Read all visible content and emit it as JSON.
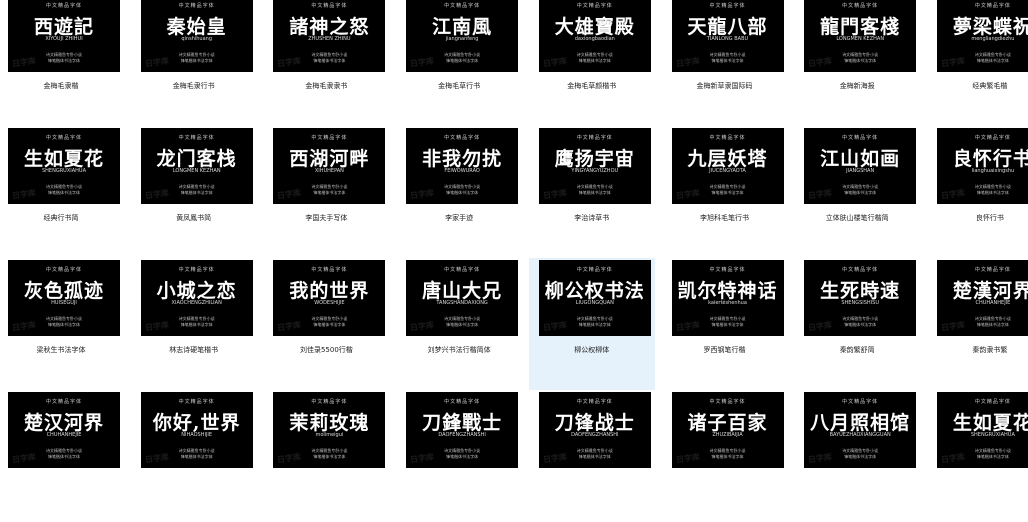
{
  "thumb_header": "中文精品字体",
  "thumb_footer_1": "诗文精雅鱼专卧小谈",
  "thumb_footer_2": "锋笔楷体书法字体",
  "watermark": "日字库",
  "items": [
    {
      "name": "sample-xiyouji",
      "sample": "西遊記",
      "sub": "XIYOUJI ZHIHUI",
      "label": "金梅毛隶楷",
      "selected": false
    },
    {
      "name": "sample-qinshihuang",
      "sample": "秦始皇",
      "sub": "qinshihuang",
      "label": "金梅毛隶行书",
      "selected": false
    },
    {
      "name": "sample-zhushen",
      "sample": "諸神之怒",
      "sub": "ZHUSHEN ZHINU",
      "label": "金梅毛隶隶书",
      "selected": false
    },
    {
      "name": "sample-jiangnanfeng",
      "sample": "江南風",
      "sub": "jiangnanfeng",
      "label": "金梅毛草行书",
      "selected": false
    },
    {
      "name": "sample-daxiong",
      "sample": "大雄寶殿",
      "sub": "daxiongbaodian",
      "label": "金梅毛草颜楷书",
      "selected": false
    },
    {
      "name": "sample-tianlong",
      "sample": "天龍八部",
      "sub": "TIANLONG BABU",
      "label": "金梅新草隶国际码",
      "selected": false
    },
    {
      "name": "sample-longmen",
      "sample": "龍門客棧",
      "sub": "LONGMEN KEZHAN",
      "label": "金梅新海报",
      "selected": false
    },
    {
      "name": "sample-mengliang",
      "sample": "夢梁蝶祝",
      "sub": "mengliangdiezhu",
      "label": "经典繁毛楷",
      "selected": false
    },
    {
      "name": "sample-shengru",
      "sample": "生如夏花",
      "sub": "SHENGRUXIAHUA",
      "label": "经典行书简",
      "selected": false
    },
    {
      "name": "sample-longmenkezhan",
      "sample": "龙门客栈",
      "sub": "LONGMEN KEZHAN",
      "label": "黄凤鳳书简",
      "selected": false
    },
    {
      "name": "sample-xihu",
      "sample": "西湖河畔",
      "sub": "XIHUHEPAN",
      "label": "李国夫手写体",
      "selected": false
    },
    {
      "name": "sample-feiwo",
      "sample": "非我勿扰",
      "sub": "FEIWOWURAO",
      "label": "李家手迹",
      "selected": false
    },
    {
      "name": "sample-yingyu",
      "sample": "鹰扬宇宙",
      "sub": "YINGYANGYUZHOU",
      "label": "李治诗草书",
      "selected": false
    },
    {
      "name": "sample-jiuceng",
      "sample": "九层妖塔",
      "sub": "JIUCENGYAOTA",
      "label": "李旭科毛笔行书",
      "selected": false
    },
    {
      "name": "sample-jiangshan",
      "sample": "江山如画",
      "sub": "JIANGSHAN",
      "label": "立体肤山楼笔行楷简",
      "selected": false
    },
    {
      "name": "sample-lianghuai",
      "sample": "良怀行书",
      "sub": "lianghuaixingshu",
      "label": "良怀行书",
      "selected": false
    },
    {
      "name": "sample-huiselinian",
      "sample": "灰色孤迹",
      "sub": "HUISEGUJI",
      "label": "梁秋生书法字体",
      "selected": false
    },
    {
      "name": "sample-xiaocheng",
      "sample": "小城之恋",
      "sub": "XIAOCHENGZHILIAN",
      "label": "林志诗硬笔楷书",
      "selected": false
    },
    {
      "name": "sample-wode",
      "sample": "我的世界",
      "sub": "WODESHIJIE",
      "label": "刘佳录5500行楷",
      "selected": false
    },
    {
      "name": "sample-tangshan",
      "sample": "唐山大兄",
      "sub": "TANGSHANDAXIONG",
      "label": "刘梦兴书法行楷简体",
      "selected": false
    },
    {
      "name": "sample-liugongquan",
      "sample": "柳公权书法",
      "sub": "LIUGONGQUAN",
      "label": "柳公权柳体",
      "selected": true
    },
    {
      "name": "sample-kaier",
      "sample": "凯尔特神话",
      "sub": "kaiertéshenhua",
      "label": "罗西钢笔行楷",
      "selected": false
    },
    {
      "name": "sample-shengsi",
      "sample": "生死時速",
      "sub": "SHENGSISHISU",
      "label": "秦韵繁舒简",
      "selected": false
    },
    {
      "name": "sample-chuhan-trad",
      "sample": "楚漢河界",
      "sub": "CHUHANHEJIE",
      "label": "秦韵隶书繁",
      "selected": false
    },
    {
      "name": "sample-chuhan",
      "sample": "楚汉河界",
      "sub": "CHUHANHEJIE",
      "label": "",
      "selected": false
    },
    {
      "name": "sample-nihao",
      "sample": "你好,世界",
      "sub": "NIHAOSHIJIE",
      "label": "",
      "selected": false
    },
    {
      "name": "sample-moli",
      "sample": "茉莉玫瑰",
      "sub": "molimeigui",
      "label": "",
      "selected": false
    },
    {
      "name": "sample-daofeng-trad",
      "sample": "刀鋒戰士",
      "sub": "DAOFENGZHANSHI",
      "label": "",
      "selected": false
    },
    {
      "name": "sample-daofeng",
      "sample": "刀锋战士",
      "sub": "DAOFENGZHANSHI",
      "label": "",
      "selected": false
    },
    {
      "name": "sample-zhuzi",
      "sample": "诸子百家",
      "sub": "ZHUZIBAIJIA",
      "label": "",
      "selected": false
    },
    {
      "name": "sample-bayue",
      "sample": "八月照相馆",
      "sub": "BAYUEZHAOXIANGGUAN",
      "label": "",
      "selected": false
    },
    {
      "name": "sample-shengru2",
      "sample": "生如夏花",
      "sub": "SHENGRUXIAHUA",
      "label": "",
      "selected": false
    }
  ]
}
